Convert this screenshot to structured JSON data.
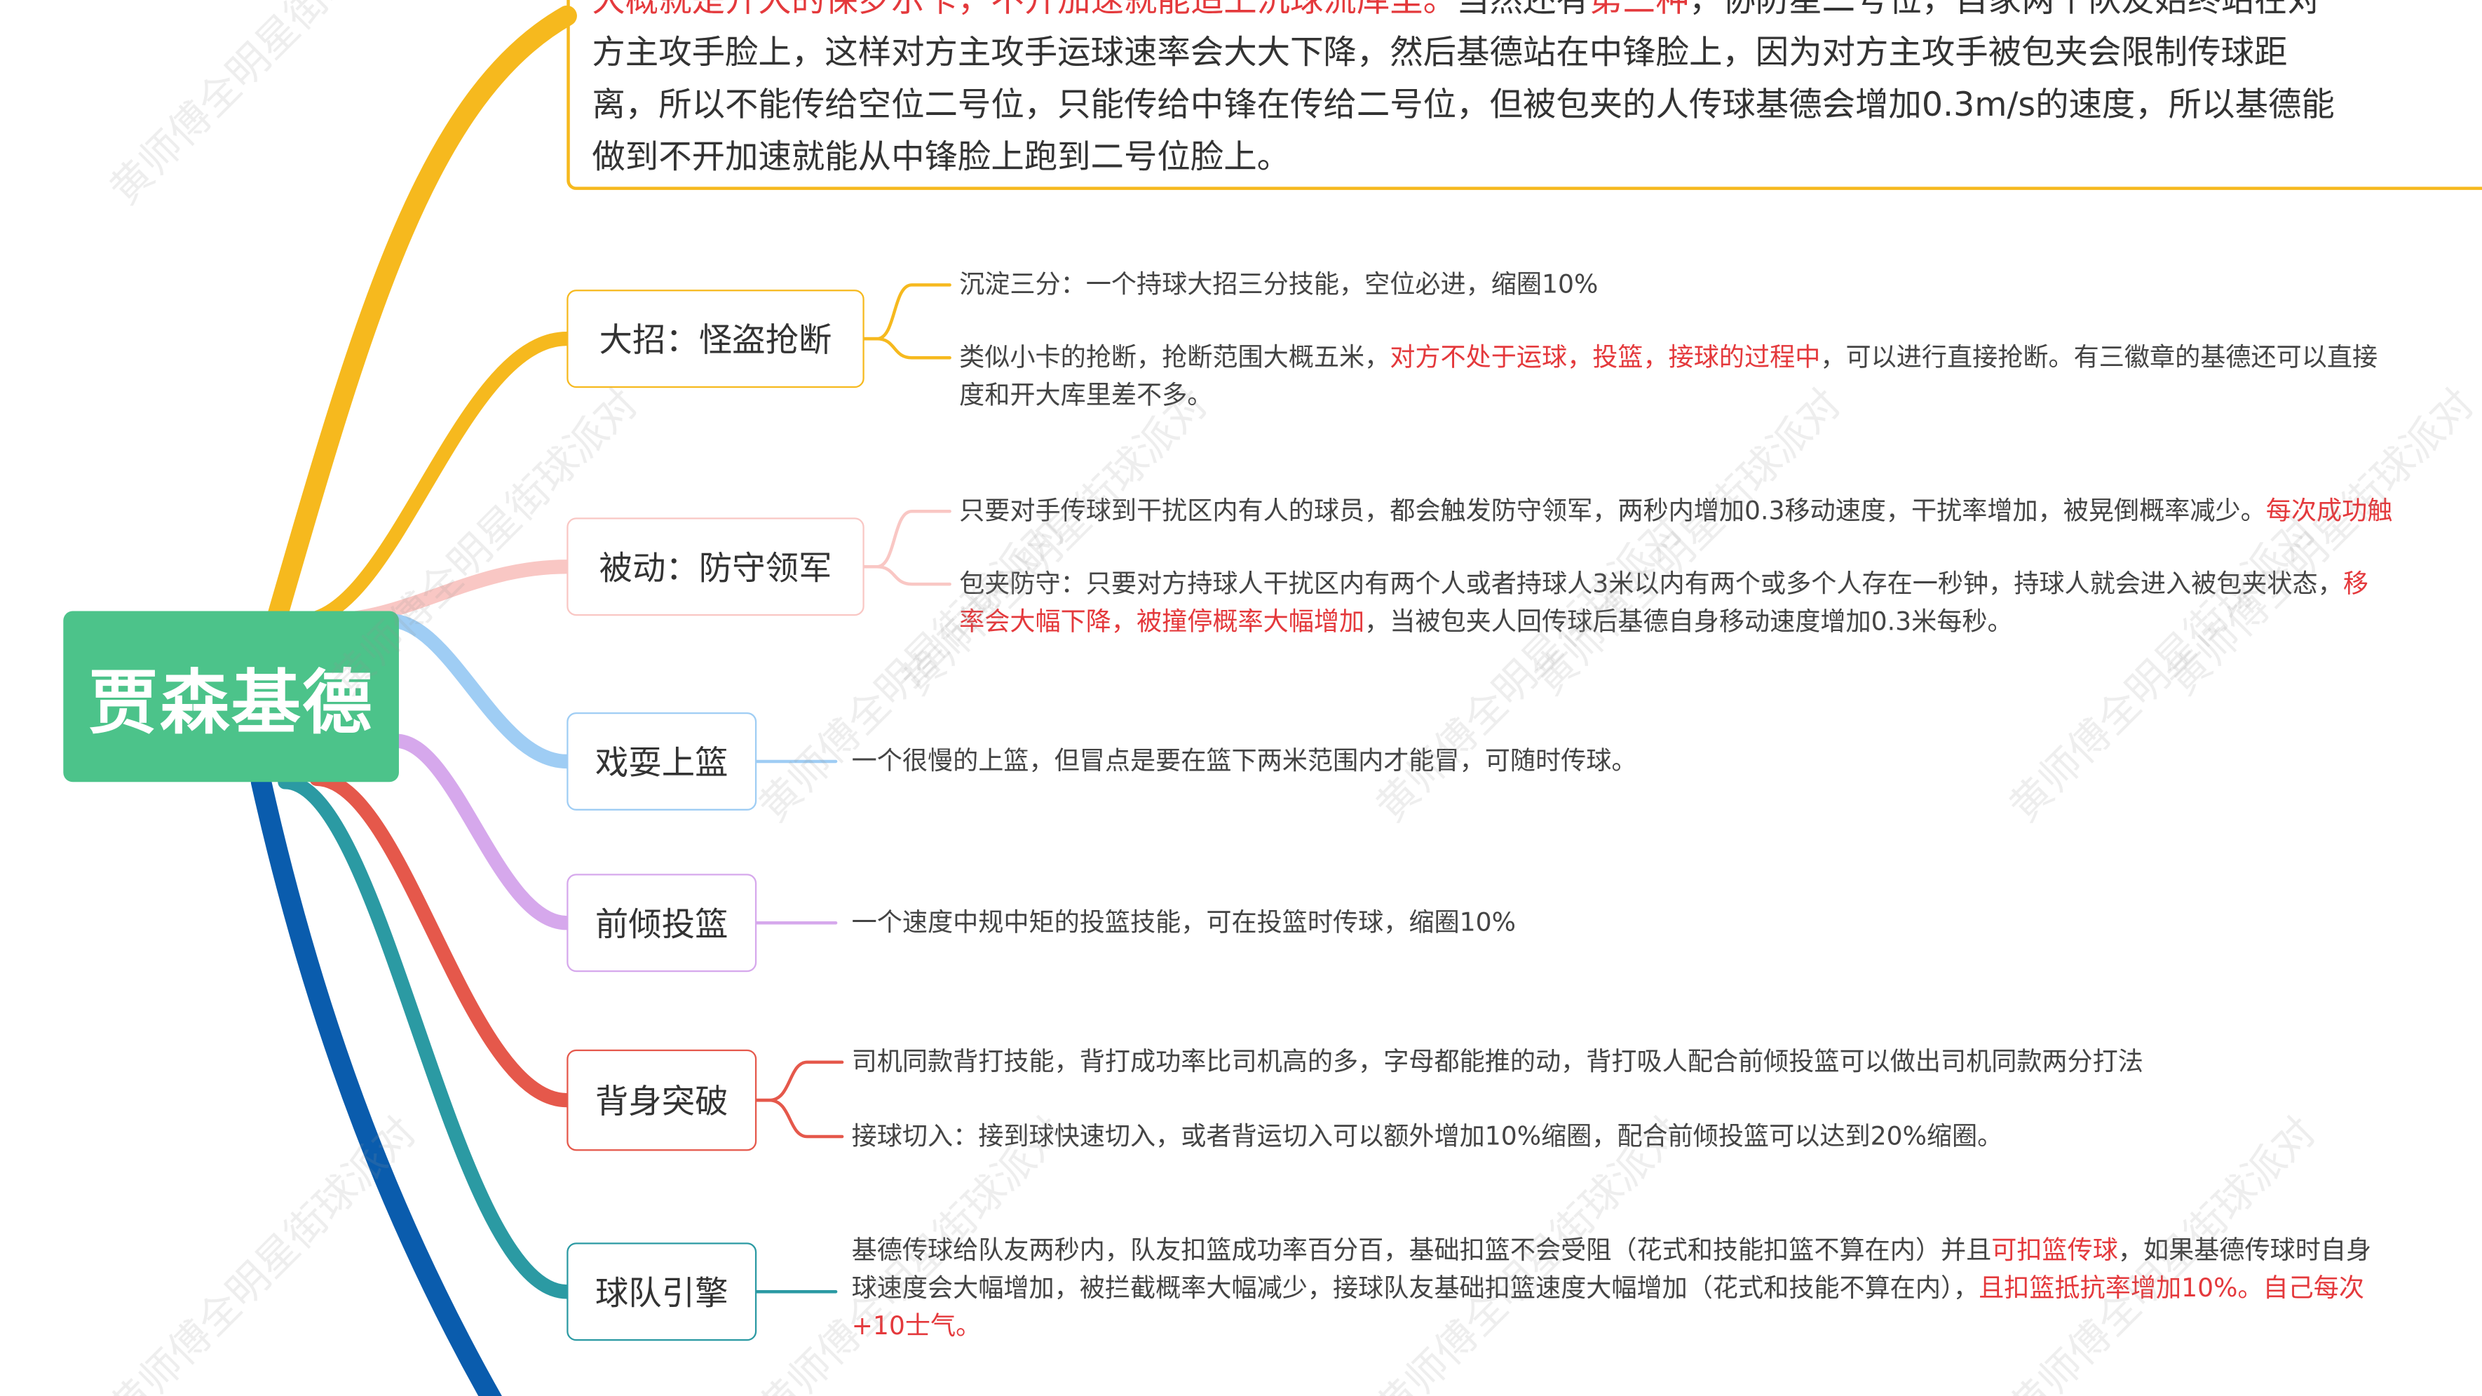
{
  "root": {
    "title": "贾森基德"
  },
  "top_note": {
    "lines": [
      [
        {
          "t": "大概就是开大的保罗示卡，不开加速就能追上沉球流库里。",
          "red": true
        },
        {
          "t": "当然还有",
          "red": false
        },
        {
          "t": "第三种",
          "red": true
        },
        {
          "t": "，协防星二号位，自家两个队友始终站在对",
          "red": false
        }
      ],
      [
        {
          "t": "方主攻手脸上，这样对方主攻手运球速率会大大下降，然后基德站在中锋脸上，因为对方主攻手被包夹会限制传球距",
          "red": false
        }
      ],
      [
        {
          "t": "离，所以不能传给空位二号位，只能传给中锋在传给二号位，但被包夹的人传球基德会增加0.3m/s的速度，所以基德能",
          "red": false
        }
      ],
      [
        {
          "t": "做到不开加速就能从中锋脸上跑到二号位脸上。",
          "red": false
        }
      ]
    ]
  },
  "branches": [
    {
      "label": "大招：怪盗抢断",
      "color": "#f6b91e",
      "leaves": [
        [
          [
            {
              "t": "沉淀三分：一个持球大招三分技能，空位必进，缩圈10%",
              "red": false
            }
          ]
        ],
        [
          [
            {
              "t": "类似小卡的抢断，抢断范围大概五米，",
              "red": false
            },
            {
              "t": "对方不处于运球，投篮，接球的过程中",
              "red": true
            },
            {
              "t": "，可以进行直接抢断。有三徽章的基德还可以直接",
              "red": false
            }
          ],
          [
            {
              "t": "度和开大库里差不多。",
              "red": false
            }
          ]
        ]
      ]
    },
    {
      "label": "被动：防守领军",
      "color": "#f9c7c4",
      "leaves": [
        [
          [
            {
              "t": "只要对手传球到干扰区内有人的球员，都会触发防守领军，两秒内增加0.3移动速度，干扰率增加，被晃倒概率减少。",
              "red": false
            },
            {
              "t": "每次成功触",
              "red": true
            }
          ]
        ],
        [
          [
            {
              "t": "包夹防守：只要对方持球人干扰区内有两个人或者持球人3米以内有两个或多个人存在一秒钟，持球人就会进入被包夹状态，",
              "red": false
            },
            {
              "t": "移",
              "red": true
            }
          ],
          [
            {
              "t": "率会大幅下降，被撞停概率大幅增加",
              "red": true
            },
            {
              "t": "，当被包夹人回传球后基德自身移动速度增加0.3米每秒。",
              "red": false
            }
          ]
        ]
      ]
    },
    {
      "label": "戏耍上篮",
      "color": "#9fcdf4",
      "leaves": [
        [
          [
            {
              "t": "一个很慢的上篮，但冒点是要在篮下两米范围内才能冒，可随时传球。",
              "red": false
            }
          ]
        ]
      ]
    },
    {
      "label": "前倾投篮",
      "color": "#d6a8ec",
      "leaves": [
        [
          [
            {
              "t": "一个速度中规中矩的投篮技能，可在投篮时传球，缩圈10%",
              "red": false
            }
          ]
        ]
      ]
    },
    {
      "label": "背身突破",
      "color": "#e5584b",
      "leaves": [
        [
          [
            {
              "t": "司机同款背打技能，背打成功率比司机高的多，字母都能推的动，背打吸人配合前倾投篮可以做出司机同款两分打法",
              "red": false
            }
          ]
        ],
        [
          [
            {
              "t": "接球切入：接到球快速切入，或者背运切入可以额外增加10%缩圈，配合前倾投篮可以达到20%缩圈。",
              "red": false
            }
          ]
        ]
      ]
    },
    {
      "label": "球队引擎",
      "color": "#2b9aa3",
      "leaves": [
        [
          [
            {
              "t": "基德传球给队友两秒内，队友扣篮成功率百分百，基础扣篮不会受阻（花式和技能扣篮不算在内）并且",
              "red": false
            },
            {
              "t": "可扣篮传球",
              "red": true
            },
            {
              "t": "，如果基德传球时自身",
              "red": false
            }
          ],
          [
            {
              "t": "球速度会大幅增加，被拦截概率大幅减少，接球队友基础扣篮速度大幅增加（花式和技能不算在内），",
              "red": false
            },
            {
              "t": "且扣篮抵抗率增加10%。自己每次",
              "red": true
            }
          ],
          [
            {
              "t": "+10士气。",
              "red": true
            }
          ]
        ]
      ]
    }
  ],
  "watermark": "黄师傅全明星街球派对",
  "colors": {
    "root": "#4cc38a",
    "deep_blue_branch": "#0a5cad",
    "red_text": "#e4393c"
  }
}
